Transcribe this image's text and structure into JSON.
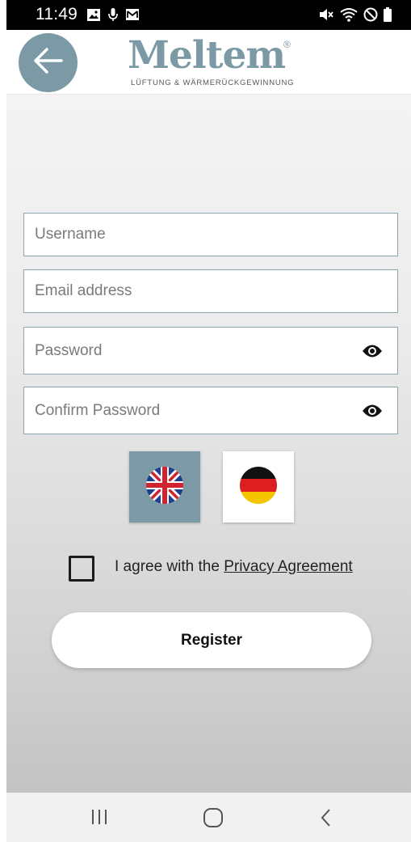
{
  "status_bar": {
    "time": "11:49",
    "left_icons": [
      "image-icon",
      "microphone-icon",
      "mail-icon"
    ],
    "right_icons": [
      "mute-icon",
      "wifi-icon",
      "do-not-disturb-icon",
      "battery-icon"
    ]
  },
  "header": {
    "back_icon": "arrow-left-icon",
    "logo_text": "Meltem",
    "logo_registered": "®",
    "logo_tagline": "LÜFTUNG & WÄRMERÜCKGEWINNUNG"
  },
  "form": {
    "username_placeholder": "Username",
    "email_placeholder": "Email address",
    "password_placeholder": "Password",
    "confirm_password_placeholder": "Confirm Password",
    "eye_icon": "eye-icon"
  },
  "languages": [
    {
      "name": "english",
      "flag": "uk-flag-icon",
      "selected": true
    },
    {
      "name": "german",
      "flag": "germany-flag-icon",
      "selected": false
    }
  ],
  "agreement": {
    "prefix": "I agree with the ",
    "link": "Privacy Agreement",
    "checked": false
  },
  "register_label": "Register",
  "nav": {
    "recents": "recents-icon",
    "home": "home-icon",
    "back": "back-icon"
  },
  "colors": {
    "accent": "#7b9aa6",
    "field_border": "#8ea3ac",
    "status_bar": "#000000"
  }
}
